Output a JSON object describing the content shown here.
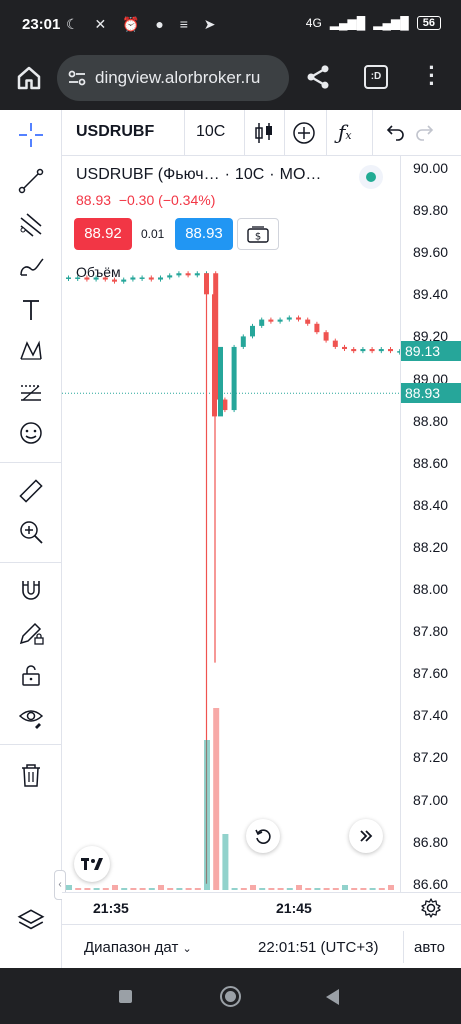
{
  "status_bar": {
    "time": "23:01",
    "network": "4G",
    "battery": "56",
    "icons": [
      "moon-icon",
      "mute-icon",
      "alarm-icon",
      "chat-icon",
      "messenger-icon",
      "telegram-icon"
    ]
  },
  "browser": {
    "url": "dingview.alorbroker.ru",
    "tabs_label": ":D"
  },
  "toolbar": {
    "symbol": "USDRUBF",
    "timeframe": "10C"
  },
  "legend": {
    "title": "USDRUBF (Фьюч…",
    "interval": "10C",
    "exchange": "MO…",
    "price": "88.93",
    "change": "−0.30",
    "change_pct": "(−0.34%)",
    "status_color": "#22ab94"
  },
  "trade": {
    "sell_price": "88.92",
    "spread": "0.01",
    "buy_price": "88.93",
    "sell_color": "#f23645",
    "buy_color": "#2196f3"
  },
  "volume_label": "Объём",
  "price_axis": {
    "labels": [
      "90.00",
      "89.80",
      "89.60",
      "89.40",
      "89.20",
      "89.00",
      "88.80",
      "88.60",
      "88.40",
      "88.20",
      "88.00",
      "87.80",
      "87.60",
      "87.40",
      "87.20",
      "87.00",
      "86.80",
      "86.60"
    ],
    "last_price_label": "89.13",
    "current_price_label": "88.93",
    "label_color": "#26a69a"
  },
  "time_axis": {
    "labels": [
      "21:35",
      "21:45"
    ]
  },
  "bottom_bar": {
    "range_label": "Диапазон дат",
    "clock": "22:01:51 (UTC+3)",
    "auto_label": "авто"
  },
  "chart_data": {
    "type": "candlestick",
    "ylim": [
      86.6,
      90.0
    ],
    "price_series": [
      89.48,
      89.48,
      89.47,
      89.48,
      89.47,
      89.46,
      89.47,
      89.48,
      89.48,
      89.47,
      89.48,
      89.49,
      89.5,
      89.49,
      89.5,
      89.5,
      88.9,
      88.85,
      89.15,
      89.2,
      89.25,
      89.28,
      89.27,
      89.28,
      89.29,
      89.28,
      89.26,
      89.22,
      89.18,
      89.15,
      89.14,
      89.13,
      89.14,
      89.13,
      89.14,
      89.13,
      89.13
    ],
    "spike_low": 86.6,
    "current_price": 88.93,
    "last_price": 89.13,
    "up_color": "#26a69a",
    "down_color": "#ef5350"
  }
}
